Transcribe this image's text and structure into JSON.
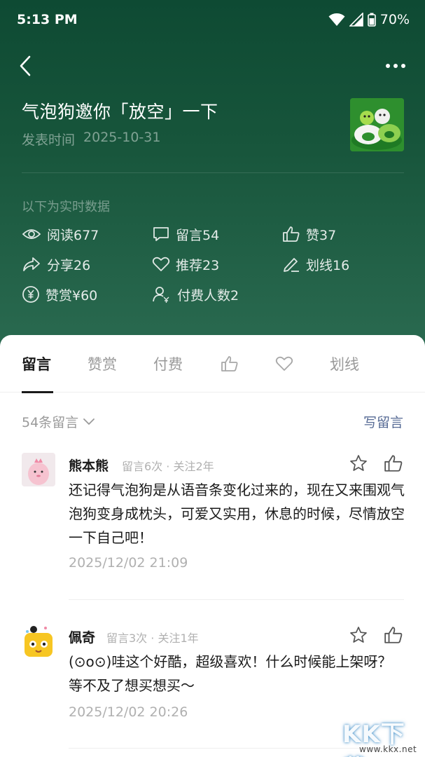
{
  "status_bar": {
    "time": "5:13 PM",
    "battery": "70%"
  },
  "article": {
    "title": "气泡狗邀你「放空」一下",
    "publish_label": "发表时间",
    "publish_date": "2025-10-31"
  },
  "stats": {
    "realtime_label": "以下为实时数据",
    "read": "阅读677",
    "comments": "留言54",
    "likes": "赞37",
    "shares": "分享26",
    "recommends": "推荐23",
    "highlights": "划线16",
    "tips": "赞赏¥60",
    "payers": "付费人数2"
  },
  "tabs": {
    "comments": "留言",
    "tips": "赞赏",
    "paid": "付费",
    "highlights": "划线"
  },
  "comments_section": {
    "count_label": "54条留言",
    "write_label": "写留言",
    "items": [
      {
        "name": "熊本熊",
        "meta": "留言6次 · 关注2年",
        "text": "还记得气泡狗是从语音条变化过来的，现在又来围观气泡狗变身成枕头，可爱又实用，休息的时候，尽情放空一下自己吧！",
        "time": "2025/12/02 21:09"
      },
      {
        "name": "佩奇",
        "meta": "留言3次 · 关注1年",
        "text": "(⊙o⊙)哇这个好酷，超级喜欢！什么时候能上架呀？等不及了想买想买～",
        "time": "2025/12/02 20:26"
      }
    ]
  },
  "watermark": {
    "main": "KK下载",
    "url": "www.kkx.net"
  },
  "colors": {
    "header_bg": "#17553b",
    "link": "#576b95",
    "accent": "#1a1a1a"
  }
}
